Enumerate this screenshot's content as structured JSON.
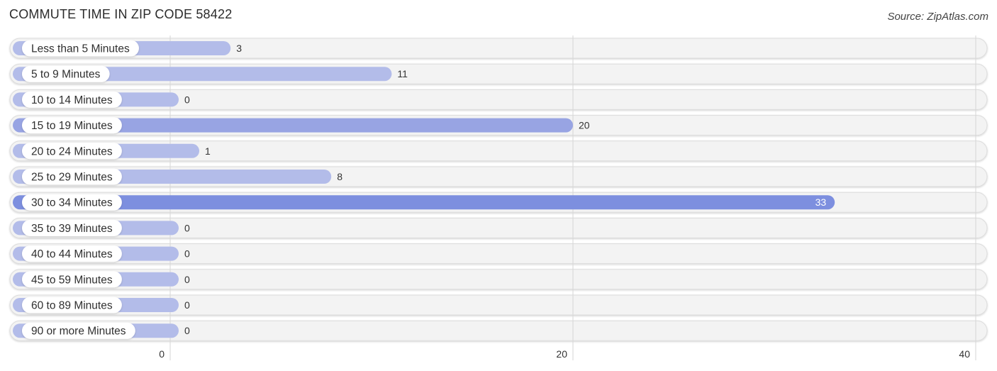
{
  "header": {
    "title": "COMMUTE TIME IN ZIP CODE 58422",
    "source": "Source: ZipAtlas.com"
  },
  "colors": {
    "bar_light": "#b3bce9",
    "bar_mid": "#98a4e3",
    "bar_strong": "#7d8fdf",
    "track": "#f3f3f3",
    "track_border": "#dcdcdc",
    "grid": "#d6d6d6"
  },
  "chart_data": {
    "type": "bar",
    "orientation": "horizontal",
    "title": "COMMUTE TIME IN ZIP CODE 58422",
    "xlabel": "",
    "ylabel": "",
    "categories": [
      "Less than 5 Minutes",
      "5 to 9 Minutes",
      "10 to 14 Minutes",
      "15 to 19 Minutes",
      "20 to 24 Minutes",
      "25 to 29 Minutes",
      "30 to 34 Minutes",
      "35 to 39 Minutes",
      "40 to 44 Minutes",
      "45 to 59 Minutes",
      "60 to 89 Minutes",
      "90 or more Minutes"
    ],
    "values": [
      3,
      11,
      0,
      20,
      1,
      8,
      33,
      0,
      0,
      0,
      0,
      0
    ],
    "xlim": [
      0,
      40
    ],
    "xticks": [
      0,
      20,
      40
    ],
    "grid": true,
    "legend": "none"
  }
}
